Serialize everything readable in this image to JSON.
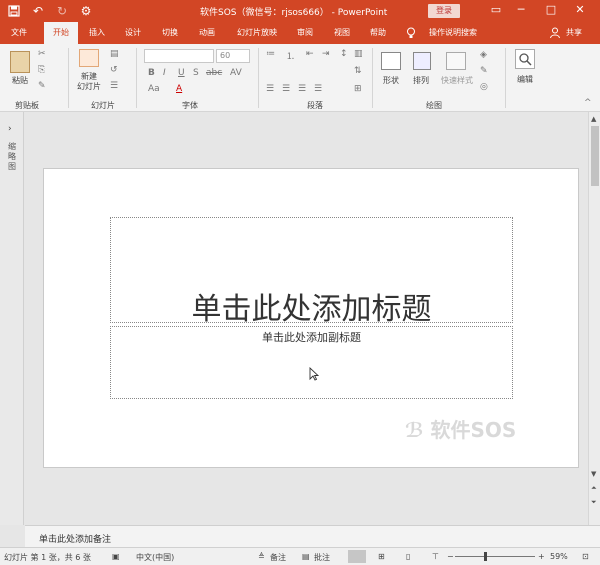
{
  "window": {
    "title": "软件SOS（微信号：rjsos666） - PowerPoint",
    "login_label": "登录",
    "min_glyph": "─",
    "max_glyph": "□",
    "close_glyph": "✕",
    "accent": "#d24625"
  },
  "qat": {
    "save_glyph": "💾",
    "undo_glyph": "↶",
    "redo_glyph": "↻",
    "custom_glyph": "⚙"
  },
  "tabs": [
    {
      "label": "文件"
    },
    {
      "label": "开始"
    },
    {
      "label": "插入"
    },
    {
      "label": "设计"
    },
    {
      "label": "切换"
    },
    {
      "label": "动画"
    },
    {
      "label": "幻灯片放映"
    },
    {
      "label": "审阅"
    },
    {
      "label": "视图"
    },
    {
      "label": "帮助"
    },
    {
      "label": "操作说明搜索"
    },
    {
      "label": "共享"
    }
  ],
  "ribbon": {
    "paste_label": "粘贴",
    "new_slide_label": "新建\n幻灯片",
    "shape_label": "形状",
    "arrange_label": "排列",
    "quick_style_label": "快速样式",
    "edit_label": "编辑",
    "font_size_value": "60",
    "groups": [
      "剪贴板",
      "幻灯片",
      "字体",
      "段落",
      "绘图"
    ],
    "font_buttons": [
      "B",
      "I",
      "U",
      "S",
      "abc",
      "AV",
      "Aa",
      "A"
    ]
  },
  "left_pane": {
    "expand_glyph": "›",
    "label": "缩略图"
  },
  "slide": {
    "title_placeholder": "单击此处添加标题",
    "subtitle_placeholder": "单击此处添加副标题"
  },
  "watermark": "软件SOS",
  "notes": {
    "placeholder": "单击此处添加备注"
  },
  "status": {
    "slide_info": "幻灯片 第 1 张，共 6 张",
    "language": "中文(中国)",
    "notes_label": "备注",
    "comments_label": "批注",
    "zoom_out": "−",
    "zoom_in": "+",
    "zoom": "59%"
  }
}
